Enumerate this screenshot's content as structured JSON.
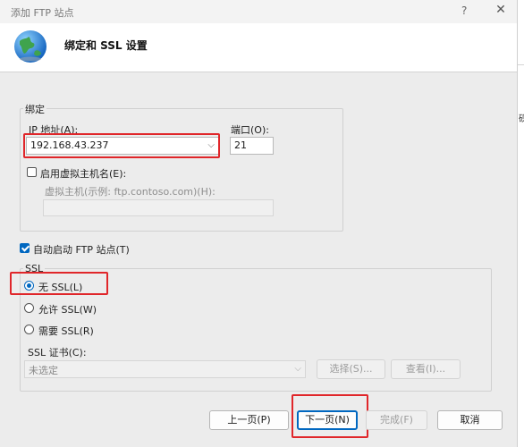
{
  "window": {
    "title": "添加 FTP 站点",
    "help_label": "?",
    "close_label": "✕",
    "icon": "globe-icon"
  },
  "header": {
    "title": "绑定和 SSL 设置"
  },
  "right_fragment": "砚",
  "binding": {
    "group_label": "绑定",
    "ip_label": "IP 地址(A):",
    "ip_value": "192.168.43.237",
    "port_label": "端口(O):",
    "port_value": "21",
    "enable_host_label": "启用虚拟主机名(E):",
    "enable_host_checked": false,
    "host_example_label": "虚拟主机(示例: ftp.contoso.com)(H):",
    "host_value": ""
  },
  "auto_start": {
    "label": "自动启动 FTP 站点(T)",
    "checked": true
  },
  "ssl": {
    "group_label": "SSL",
    "options": [
      {
        "label": "无 SSL(L)",
        "selected": true
      },
      {
        "label": "允许 SSL(W)",
        "selected": false
      },
      {
        "label": "需要 SSL(R)",
        "selected": false
      }
    ],
    "cert_label": "SSL 证书(C):",
    "cert_value": "未选定",
    "select_button": "选择(S)...",
    "view_button": "查看(I)..."
  },
  "buttons": {
    "prev": "上一页(P)",
    "next": "下一页(N)",
    "finish": "完成(F)",
    "cancel": "取消"
  },
  "colors": {
    "accent": "#0067c0",
    "highlight": "#e0262a"
  }
}
